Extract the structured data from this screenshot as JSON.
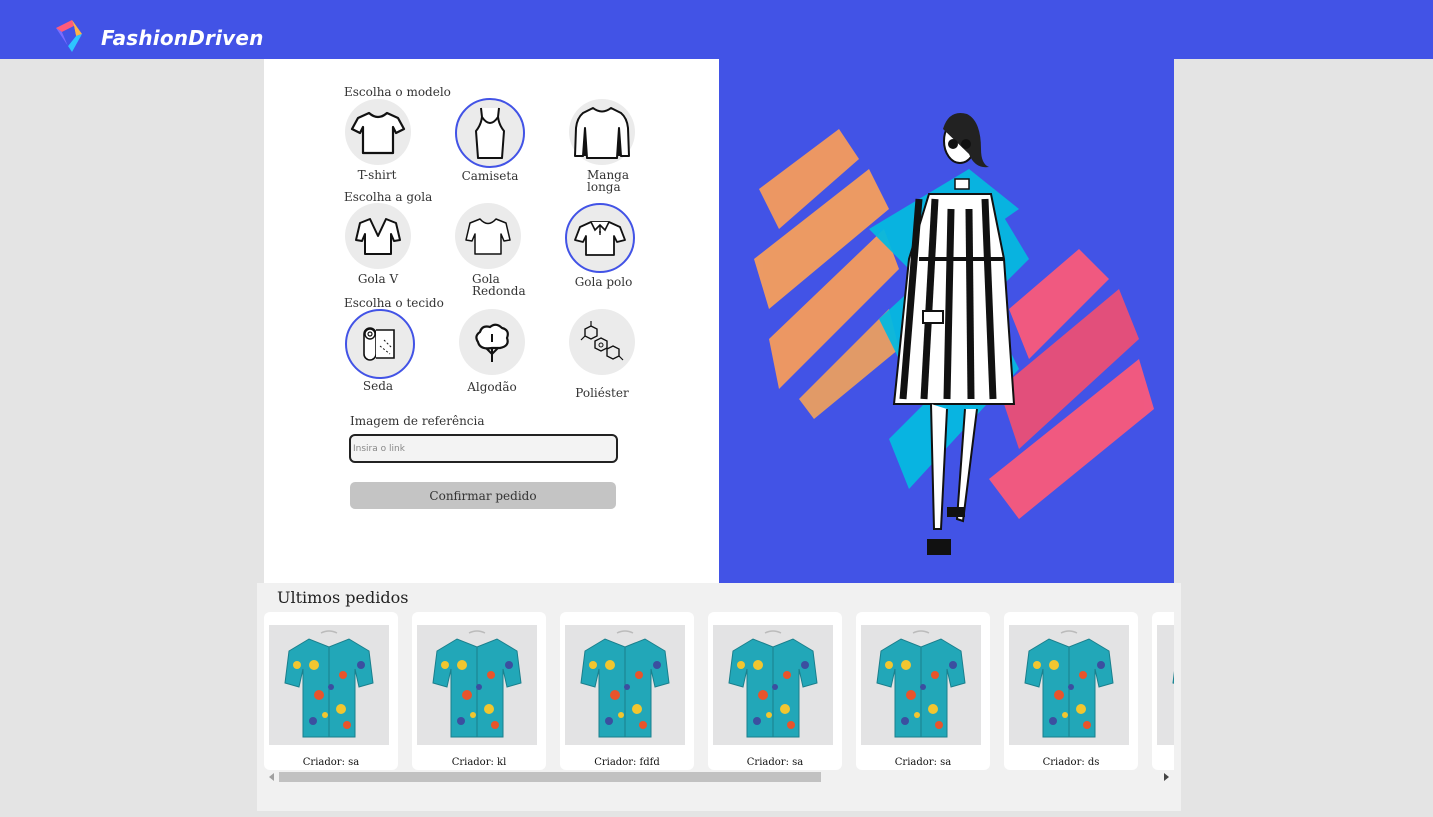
{
  "app": {
    "brand": "FashionDriven",
    "brand_color": "#4253e6"
  },
  "form": {
    "model": {
      "label": "Escolha o modelo",
      "options": [
        {
          "label": "T-shirt",
          "icon": "tshirt-icon",
          "selected": false
        },
        {
          "label": "Camiseta",
          "icon": "tank-top-icon",
          "selected": true
        },
        {
          "label": "Manga longa",
          "icon": "long-sleeve-icon",
          "selected": false
        }
      ]
    },
    "collar": {
      "label": "Escolha a gola",
      "options": [
        {
          "label": "Gola V",
          "icon": "v-neck-icon",
          "selected": false
        },
        {
          "label": "Gola Redonda",
          "icon": "round-neck-icon",
          "selected": false
        },
        {
          "label": "Gola polo",
          "icon": "polo-icon",
          "selected": true
        }
      ]
    },
    "fabric": {
      "label": "Escolha o tecido",
      "options": [
        {
          "label": "Seda",
          "icon": "silk-roll-icon",
          "selected": true
        },
        {
          "label": "Algodão",
          "icon": "cotton-icon",
          "selected": false
        },
        {
          "label": "Poliéster",
          "icon": "polyester-molecule-icon",
          "selected": false
        }
      ]
    },
    "reference": {
      "label": "Imagem de referência",
      "placeholder": "Insira o link",
      "value": ""
    },
    "confirm_label": "Confirmar pedido"
  },
  "orders": {
    "title": "Ultimos pedidos",
    "items": [
      {
        "creator": "Criador: sa"
      },
      {
        "creator": "Criador: kl"
      },
      {
        "creator": "Criador: fdfd"
      },
      {
        "creator": "Criador: sa"
      },
      {
        "creator": "Criador: sa"
      },
      {
        "creator": "Criador: ds"
      },
      {
        "creator": ""
      }
    ]
  }
}
